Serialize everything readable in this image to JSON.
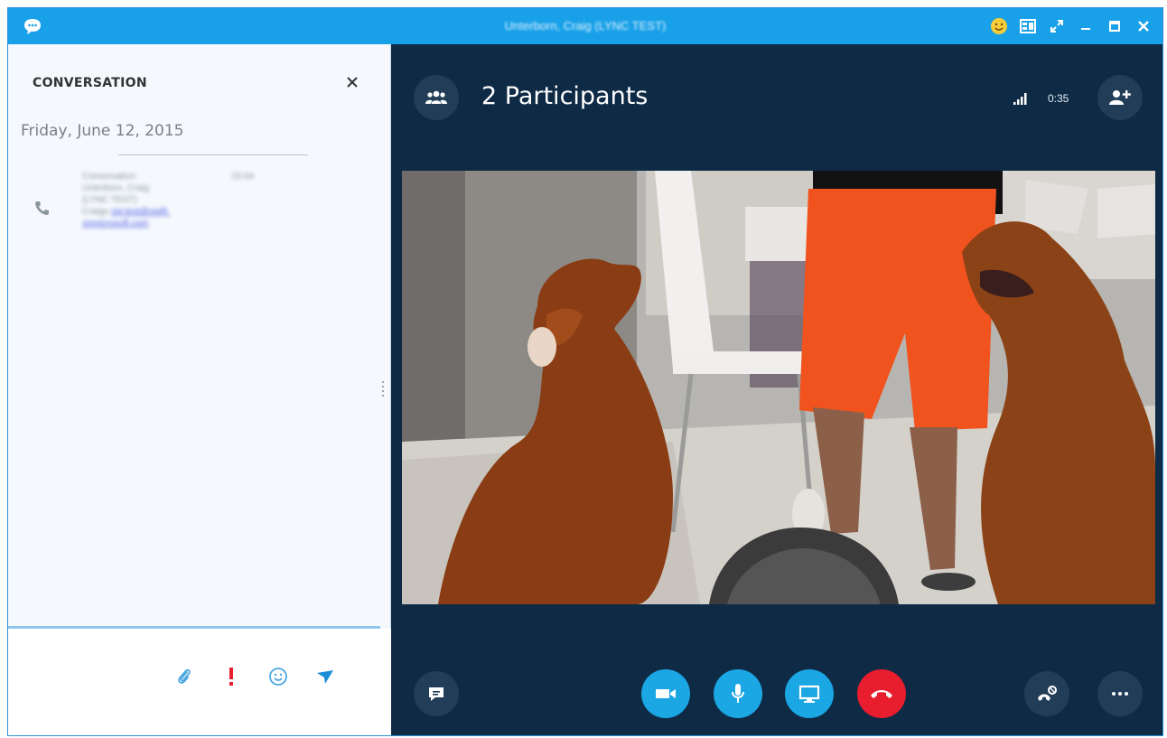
{
  "window": {
    "title": "Unterborn, Craig (LYNC TEST)"
  },
  "conversation": {
    "heading": "CONVERSATION",
    "date": "Friday, June 12, 2015",
    "message": {
      "line1": "Conversation",
      "time": "15:04",
      "line2": "Unterborn, Craig",
      "line3": "(LYNC TEST)",
      "line4_prefix": "Craigu ",
      "link_part1": "sip:test@swift.",
      "link_part2": "onmicrosoft.com"
    }
  },
  "call": {
    "participants_label": "2 Participants",
    "duration": "0:35"
  },
  "icons": {
    "app": "chat-bubble-icon",
    "emoji": "smiley-icon",
    "layout": "layout-icon",
    "fullscreen": "expand-icon",
    "minimize": "minimize-icon",
    "maximize": "maximize-icon",
    "close": "close-icon",
    "participants": "people-icon",
    "signal": "signal-icon",
    "add_person": "add-person-icon",
    "attach": "paperclip-icon",
    "importance": "exclamation-icon",
    "emoticon": "smiley-icon",
    "send": "send-icon",
    "chat": "chat-icon",
    "video": "video-camera-icon",
    "mic": "microphone-icon",
    "share": "monitor-icon",
    "hangup": "hang-up-icon",
    "call_controls": "dialpad-icon",
    "more": "more-icon"
  },
  "colors": {
    "titlebar": "#18a0e8",
    "stage": "#0e2a45",
    "call_button": "#1ba6e4",
    "hangup": "#e81d2d",
    "importance": "#e81d2d",
    "accent": "#1ba6e4"
  }
}
